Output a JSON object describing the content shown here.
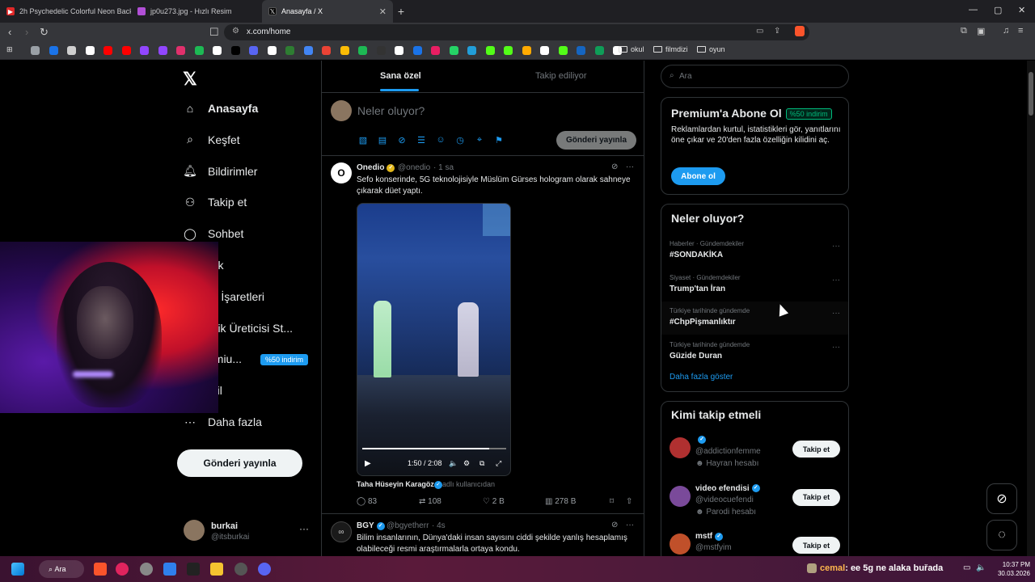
{
  "browser": {
    "tabs": [
      {
        "title": "2h Psychedelic Colorful Neon Backgr",
        "fav_color": "#e02828"
      },
      {
        "title": "jp0u273.jpg - Hızlı Resim",
        "fav_color": "#b14fd6"
      },
      {
        "title": "Anasayfa / X",
        "fav_color": "#000000",
        "active": true
      }
    ],
    "new_tab": "+",
    "url": "x.com/home",
    "window_controls": {
      "minimize": "—",
      "maximize": "▢",
      "close": "✕"
    },
    "bookmark_folders": [
      "okul",
      "filmdizi",
      "oyun"
    ],
    "bookmark_colors": [
      "#9aa0a6",
      "#1a73e8",
      "#cfcfcf",
      "#ffffff",
      "#ff0000",
      "#ff0000",
      "#9146ff",
      "#9146ff",
      "#e1306c",
      "#1db954",
      "#ffffff",
      "#000000",
      "#5865f2",
      "#ffffff",
      "#2e7d32",
      "#4285f4",
      "#ea4335",
      "#fbbc05",
      "#1db954",
      "#333333",
      "#ffffff",
      "#1a73e8",
      "#e91e63",
      "#25d366",
      "#229ed9",
      "#53fc18",
      "#53fc18",
      "#ffaa00",
      "#ffffff",
      "#53fc18",
      "#1565c0",
      "#0f9d58",
      "#ffffff"
    ]
  },
  "nav": {
    "logo": "𝕏",
    "items": [
      {
        "label": "Anasayfa",
        "icon": "home-icon"
      },
      {
        "label": "Keşfet",
        "icon": "search-icon"
      },
      {
        "label": "Bildirimler",
        "icon": "bell-icon"
      },
      {
        "label": "Takip et",
        "icon": "person-add-icon"
      },
      {
        "label": "Sohbet",
        "icon": "chat-icon"
      },
      {
        "label": "rok",
        "icon": "grok-icon"
      },
      {
        "label": "er İşaretleri",
        "icon": "bookmark-icon"
      },
      {
        "label": "erik Üreticisi St...",
        "icon": "lightning-icon"
      },
      {
        "label": "emiu...",
        "icon": "premium-icon"
      },
      {
        "label": "ofil",
        "icon": "profile-icon"
      },
      {
        "label": "Daha fazla",
        "icon": "more-circle-icon"
      }
    ],
    "premium_badge": "%50 indirim",
    "post_button": "Gönderi yayınla",
    "me": {
      "name": "burkai",
      "handle": "@itsburkai",
      "dots": "···"
    }
  },
  "feed": {
    "tabs": [
      "Sana özel",
      "Takip ediliyor"
    ],
    "compose_placeholder": "Neler oluyor?",
    "compose_button": "Gönderi yayınla",
    "tweets": [
      {
        "name": "Onedio",
        "handle": "@onedio",
        "time": "· 1 sa",
        "text": "Sefo konserinde, 5G teknolojisiyle Müslüm Gürses hologram olarak sahneye çıkarak düet yaptı.",
        "video_time": "1:50 / 2:08",
        "video_progress": 0.88,
        "credit_name": "Taha Hüseyin Karagöz",
        "credit_suffix": "adlı kullanıcıdan",
        "stats": {
          "replies": "83",
          "retweets": "108",
          "likes": "2 B",
          "views": "278 B"
        }
      },
      {
        "name": "BGY",
        "handle": "@bgyetherr",
        "time": "· 4s",
        "text": "Bilim insanlarının, Dünya'daki insan sayısını ciddi şekilde yanlış hesaplamış olabileceği resmi araştırmalarla ortaya kondu."
      }
    ]
  },
  "sidebar": {
    "search_placeholder": "Ara",
    "premium": {
      "title": "Premium'a Abone Ol",
      "badge": "%50 indirim",
      "text": "Reklamlardan kurtul, istatistikleri gör, yanıtlarını öne çıkar ve 20'den fazla özelliğin kilidini aç.",
      "button": "Abone ol"
    },
    "trends": {
      "title": "Neler oluyor?",
      "items": [
        {
          "category": "Haberler · Gündemdekiler",
          "name": "#SONDAKİKA"
        },
        {
          "category": "Siyaset · Gündemdekiler",
          "name": "Trump'tan İran"
        },
        {
          "category": "Türkiye tarihinde gündemde",
          "name": "#ChpPişmanlıktır"
        },
        {
          "category": "Türkiye tarihinde gündemde",
          "name": "Güzide Duran"
        }
      ],
      "show_more": "Daha fazla göster"
    },
    "who_to_follow": {
      "title": "Kimi takip etmeli",
      "items": [
        {
          "name": "",
          "handle": "@addictionfemme",
          "label": "Hayran hesabı",
          "button": "Takip et",
          "avatar": "#b03030"
        },
        {
          "name": "video efendisi",
          "handle": "@videocuefendi",
          "label": "Parodi hesabı",
          "button": "Takip et",
          "avatar": "#7a4a9a"
        },
        {
          "name": "mstf",
          "handle": "@mstfyim",
          "label": "",
          "button": "Takip et",
          "avatar": "#c0502a"
        }
      ]
    }
  },
  "taskbar": {
    "search": "Ara",
    "ticker_user": "cemal",
    "ticker_sep": ":",
    "ticker_msg": "ee 5g ne alaka buřada",
    "time": "10:37 PM",
    "date": "30.03.2026"
  }
}
